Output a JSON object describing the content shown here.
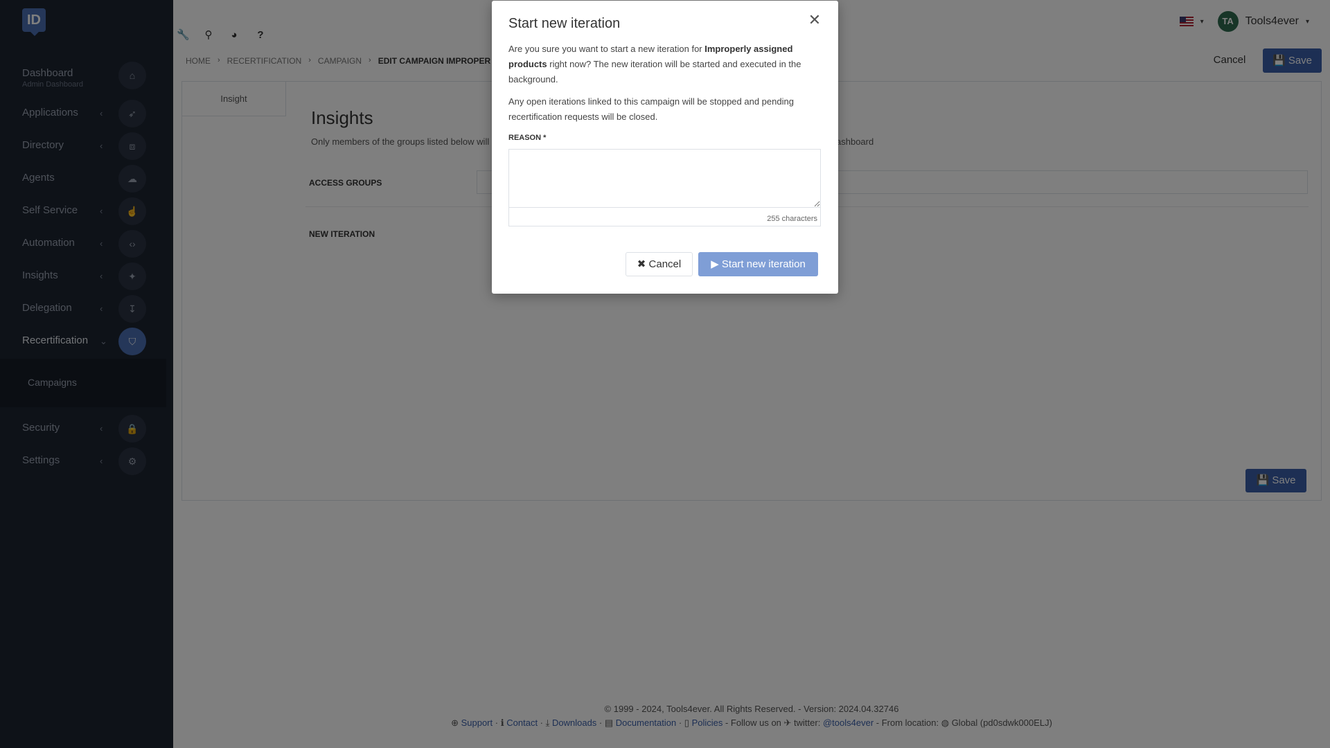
{
  "sidebar": {
    "logo": "ID",
    "items": [
      {
        "label": "Dashboard",
        "sub": "Admin Dashboard",
        "icon": "home-icon",
        "glyph": "⌂",
        "chevron": ""
      },
      {
        "label": "Applications",
        "icon": "rocket-icon",
        "glyph": "➶",
        "chevron": "‹"
      },
      {
        "label": "Directory",
        "icon": "sitemap-icon",
        "glyph": "⧈",
        "chevron": "‹"
      },
      {
        "label": "Agents",
        "icon": "cloud-icon",
        "glyph": "☁",
        "chevron": ""
      },
      {
        "label": "Self Service",
        "icon": "hand-icon",
        "glyph": "☝",
        "chevron": "‹"
      },
      {
        "label": "Automation",
        "icon": "code-icon",
        "glyph": "‹›",
        "chevron": "‹"
      },
      {
        "label": "Insights",
        "icon": "lightbulb-icon",
        "glyph": "✦",
        "chevron": "‹"
      },
      {
        "label": "Delegation",
        "icon": "delegation-icon",
        "glyph": "↧",
        "chevron": "‹"
      },
      {
        "label": "Recertification",
        "icon": "shield-icon",
        "glyph": "⛉",
        "chevron": "⌄"
      },
      {
        "label": "Security",
        "icon": "lock-icon",
        "glyph": "🔒",
        "chevron": "‹"
      },
      {
        "label": "Settings",
        "icon": "gear-icon",
        "glyph": "⚙",
        "chevron": "‹"
      }
    ],
    "submenu": {
      "label": "Campaigns"
    }
  },
  "toolbar": {
    "icons": [
      {
        "name": "wrench-icon",
        "glyph": "🔧"
      },
      {
        "name": "sitemap-tool-icon",
        "glyph": "⚲"
      },
      {
        "name": "pie-chart-icon",
        "glyph": "◕"
      },
      {
        "name": "help-icon",
        "glyph": "?"
      }
    ]
  },
  "user": {
    "initials": "TA",
    "name": "Tools4ever"
  },
  "breadcrumb": [
    "HOME",
    "RECERTIFICATION",
    "CAMPAIGN",
    "EDIT CAMPAIGN IMPROPER"
  ],
  "header": {
    "cancel": "Cancel",
    "save": "Save"
  },
  "content": {
    "tab": "Insight",
    "title": "Insights",
    "desc": "Only members of the groups listed below will",
    "desc_end": "ashboard",
    "access_groups_label": "ACCESS GROUPS",
    "new_iteration_label": "NEW ITERATION",
    "save": "Save"
  },
  "footer": {
    "line1": "© 1999 - 2024, Tools4ever. All Rights Reserved. - Version: 2024.04.32746",
    "support": "Support",
    "contact": "Contact",
    "downloads": "Downloads",
    "documentation": "Documentation",
    "policies": "Policies",
    "follow": "- Follow us on",
    "twitter_label": "twitter:",
    "twitter": "@tools4ever",
    "location": "- From location:",
    "location_value": "Global (pd0sdwk000ELJ)"
  },
  "modal": {
    "title": "Start new iteration",
    "text1_a": "Are you sure you want to start a new iteration for ",
    "text1_b": "Improperly assigned products",
    "text1_c": " right now? The new iteration will be started and executed in the background.",
    "text2": "Any open iterations linked to this campaign will be stopped and pending recertification requests will be closed.",
    "reason_label": "REASON *",
    "reason_value": "",
    "char_count": "255 characters",
    "cancel": "Cancel",
    "start": "Start new iteration"
  },
  "colors": {
    "sidebar_bg": "#1d2431",
    "accent": "#3a5fa8",
    "start_button_disabled": "#7f9ed6"
  }
}
